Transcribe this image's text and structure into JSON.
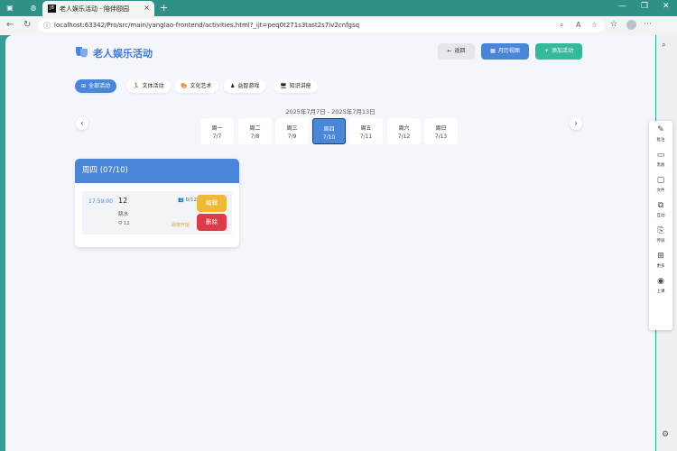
{
  "browser": {
    "tab_title": "老人娱乐活动 - 陪伴颐园",
    "address": "localhost:63342/Pro/src/main/yanglao-frontend/activities.html?_ijt=peq0t271s3tast2s7iv2cnfgsq"
  },
  "header": {
    "title": "老人娱乐活动",
    "back_label": "返回",
    "month_view_label": "月历视图",
    "add_label": "添加活动"
  },
  "filters": [
    {
      "label": "全部活动",
      "icon": "grid-icon"
    },
    {
      "label": "文体活动",
      "icon": "runner-icon"
    },
    {
      "label": "文化艺术",
      "icon": "palette-icon"
    },
    {
      "label": "益智游戏",
      "icon": "puzzle-icon"
    },
    {
      "label": "知识讲座",
      "icon": "lecture-icon"
    }
  ],
  "week": {
    "range": "2025年7月7日 - 2025年7月13日",
    "days": [
      {
        "name": "周一",
        "date": "7/7"
      },
      {
        "name": "周二",
        "date": "7/8"
      },
      {
        "name": "周三",
        "date": "7/9"
      },
      {
        "name": "周四",
        "date": "7/10"
      },
      {
        "name": "周五",
        "date": "7/11"
      },
      {
        "name": "周六",
        "date": "7/12"
      },
      {
        "name": "周日",
        "date": "7/13"
      }
    ]
  },
  "day_card": {
    "title": "周四 (07/10)",
    "activity": {
      "time": "17:59:00",
      "title": "12",
      "category": "跳水",
      "location": "12",
      "participants": "0/12",
      "status": "即将开始",
      "edit_label": "编辑",
      "delete_label": "删除"
    }
  },
  "edge_sidebar": [
    "批注",
    "黑板",
    "文件",
    "互动",
    "传屏",
    "更多",
    "上课"
  ],
  "colors": {
    "primary": "#4a86d8",
    "success": "#36b89a",
    "warning": "#f0b83a",
    "danger": "#dc3b4a"
  }
}
